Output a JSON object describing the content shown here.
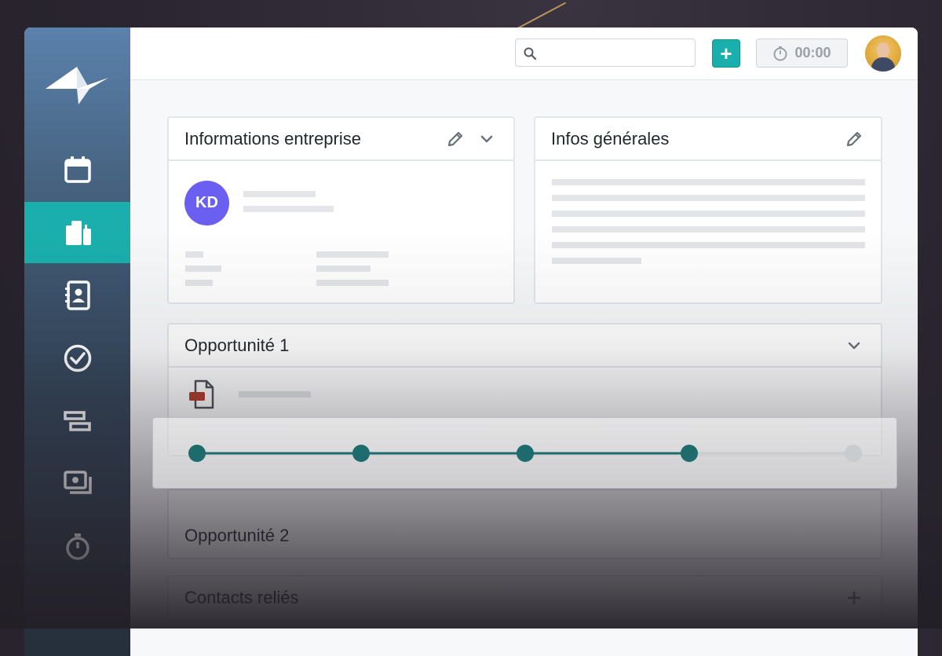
{
  "topbar": {
    "search_placeholder": "",
    "add_label": "+",
    "timer": "00:00"
  },
  "sidebar": {
    "items": [
      {
        "icon": "calendar-icon",
        "active": false
      },
      {
        "icon": "companies-icon",
        "active": true
      },
      {
        "icon": "contacts-book-icon",
        "active": false
      },
      {
        "icon": "check-circle-icon",
        "active": false
      },
      {
        "icon": "pipeline-icon",
        "active": false
      },
      {
        "icon": "billing-icon",
        "active": false
      },
      {
        "icon": "timer-icon",
        "active": false
      }
    ]
  },
  "company_card": {
    "title": "Informations entreprise",
    "avatar_initials": "KD"
  },
  "general_card": {
    "title": "Infos générales"
  },
  "opportunity1": {
    "title": "Opportunité 1",
    "stepper": {
      "total_steps": 5,
      "completed_steps": 4
    }
  },
  "opportunity2": {
    "title": "Opportunité 2"
  },
  "contacts": {
    "title": "Contacts reliés",
    "add_label": "+"
  },
  "colors": {
    "accent": "#1aafac",
    "avatar_purple": "#6a5ff0",
    "step_done": "#1e6b6e",
    "step_todo": "#c9cbcf"
  }
}
